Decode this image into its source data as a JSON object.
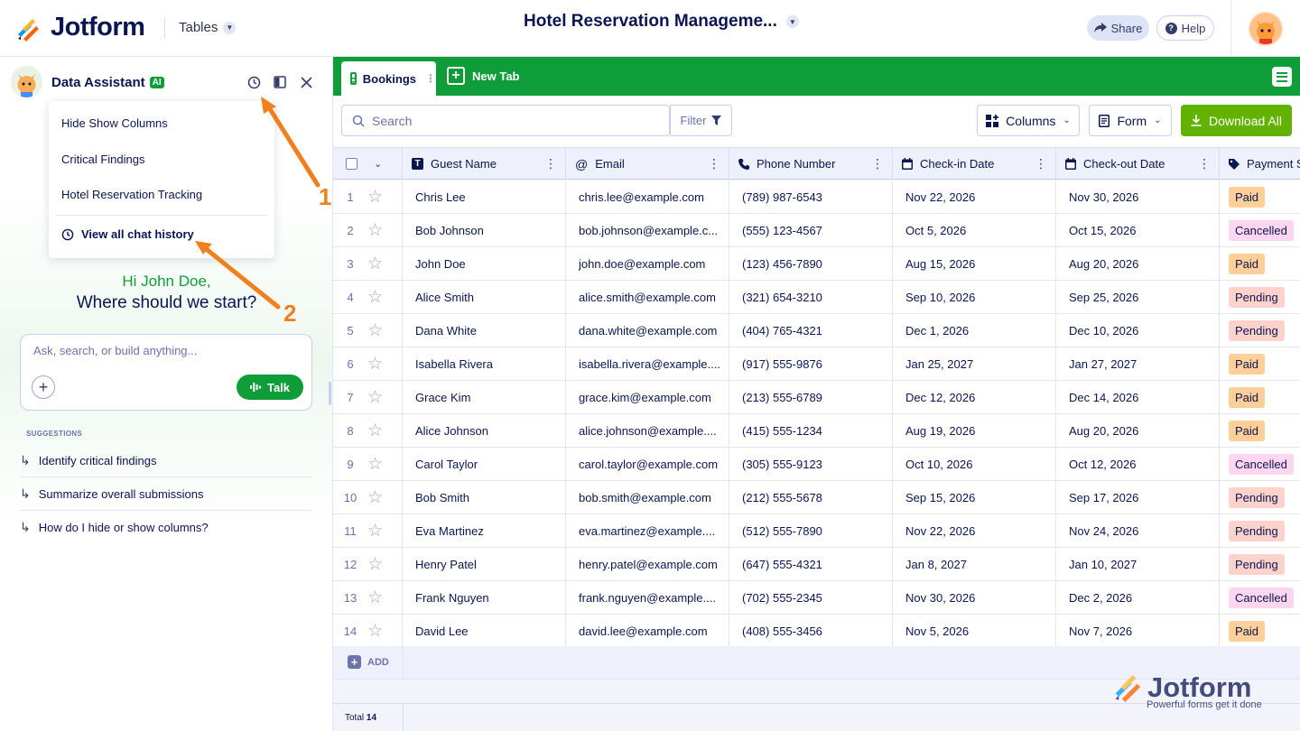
{
  "header": {
    "logo_text": "Jotform",
    "tables_label": "Tables",
    "doc_title": "Hotel Reservation Manageme...",
    "share_label": "Share",
    "help_label": "Help"
  },
  "assistant": {
    "title": "Data Assistant",
    "ai_badge": "AI",
    "history_items": [
      "Hide Show Columns",
      "Critical Findings",
      "Hotel Reservation Tracking"
    ],
    "view_history_label": "View all chat history",
    "greeting_line1": "Hi John Doe,",
    "greeting_line2": "Where should we start?",
    "input_placeholder": "Ask, search, or build anything...",
    "talk_label": "Talk",
    "suggestions_heading": "SUGGESTIONS",
    "suggestions": [
      "Identify critical findings",
      "Summarize overall submissions",
      "How do I hide or show columns?"
    ]
  },
  "annotations": [
    "1",
    "2"
  ],
  "tabs": {
    "active_label": "Bookings",
    "new_tab_label": "New Tab"
  },
  "toolbar": {
    "search_placeholder": "Search",
    "filter_label": "Filter",
    "columns_label": "Columns",
    "form_label": "Form",
    "download_label": "Download All"
  },
  "table": {
    "columns": [
      "Guest Name",
      "Email",
      "Phone Number",
      "Check-in Date",
      "Check-out Date",
      "Payment S"
    ],
    "rows": [
      {
        "n": "1",
        "name": "Chris Lee",
        "email": "chris.lee@example.com",
        "phone": "(789) 987-6543",
        "in": "Nov 22, 2026",
        "out": "Nov 30, 2026",
        "status": "Paid"
      },
      {
        "n": "2",
        "name": "Bob Johnson",
        "email": "bob.johnson@example.c...",
        "phone": "(555) 123-4567",
        "in": "Oct 5, 2026",
        "out": "Oct 15, 2026",
        "status": "Cancelled"
      },
      {
        "n": "3",
        "name": "John Doe",
        "email": "john.doe@example.com",
        "phone": "(123) 456-7890",
        "in": "Aug 15, 2026",
        "out": "Aug 20, 2026",
        "status": "Paid"
      },
      {
        "n": "4",
        "name": "Alice Smith",
        "email": "alice.smith@example.com",
        "phone": "(321) 654-3210",
        "in": "Sep 10, 2026",
        "out": "Sep 25, 2026",
        "status": "Pending"
      },
      {
        "n": "5",
        "name": "Dana White",
        "email": "dana.white@example.com",
        "phone": "(404) 765-4321",
        "in": "Dec 1, 2026",
        "out": "Dec 10, 2026",
        "status": "Pending"
      },
      {
        "n": "6",
        "name": "Isabella Rivera",
        "email": "isabella.rivera@example....",
        "phone": "(917) 555-9876",
        "in": "Jan 25, 2027",
        "out": "Jan 27, 2027",
        "status": "Paid"
      },
      {
        "n": "7",
        "name": "Grace Kim",
        "email": "grace.kim@example.com",
        "phone": "(213) 555-6789",
        "in": "Dec 12, 2026",
        "out": "Dec 14, 2026",
        "status": "Paid"
      },
      {
        "n": "8",
        "name": "Alice Johnson",
        "email": "alice.johnson@example....",
        "phone": "(415) 555-1234",
        "in": "Aug 19, 2026",
        "out": "Aug 20, 2026",
        "status": "Paid"
      },
      {
        "n": "9",
        "name": "Carol Taylor",
        "email": "carol.taylor@example.com",
        "phone": "(305) 555-9123",
        "in": "Oct 10, 2026",
        "out": "Oct 12, 2026",
        "status": "Cancelled"
      },
      {
        "n": "10",
        "name": "Bob Smith",
        "email": "bob.smith@example.com",
        "phone": "(212) 555-5678",
        "in": "Sep 15, 2026",
        "out": "Sep 17, 2026",
        "status": "Pending"
      },
      {
        "n": "11",
        "name": "Eva Martinez",
        "email": "eva.martinez@example....",
        "phone": "(512) 555-7890",
        "in": "Nov 22, 2026",
        "out": "Nov 24, 2026",
        "status": "Pending"
      },
      {
        "n": "12",
        "name": "Henry Patel",
        "email": "henry.patel@example.com",
        "phone": "(647) 555-4321",
        "in": "Jan 8, 2027",
        "out": "Jan 10, 2027",
        "status": "Pending"
      },
      {
        "n": "13",
        "name": "Frank Nguyen",
        "email": "frank.nguyen@example....",
        "phone": "(702) 555-2345",
        "in": "Nov 30, 2026",
        "out": "Dec 2, 2026",
        "status": "Cancelled"
      },
      {
        "n": "14",
        "name": "David Lee",
        "email": "david.lee@example.com",
        "phone": "(408) 555-3456",
        "in": "Nov 5, 2026",
        "out": "Nov 7, 2026",
        "status": "Paid"
      }
    ],
    "add_label": "ADD",
    "total_label": "Total",
    "total_count": "14"
  },
  "watermark": {
    "text": "Jotform",
    "tagline": "Powerful forms get it done"
  },
  "colors": {
    "brand_green": "#0f9d3a",
    "download_green": "#64b200",
    "annotation_orange": "#f0801e",
    "navy": "#0a1551"
  }
}
